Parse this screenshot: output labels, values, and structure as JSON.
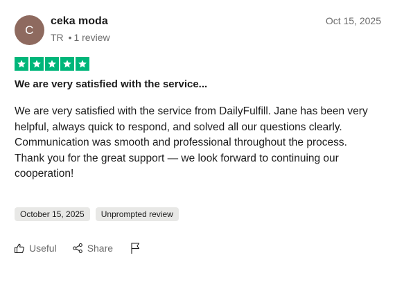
{
  "reviewer": {
    "initial": "C",
    "name": "ceka moda",
    "country": "TR",
    "separator": "•",
    "review_count": "1 review",
    "avatar_color": "#8e6a5f"
  },
  "review": {
    "date": "Oct 15, 2025",
    "rating": 5,
    "star_color": "#00b67a",
    "title": "We are very satisfied with the service...",
    "body_paragraphs": [
      "We are very satisfied with the service from DailyFulfill. Jane has been very helpful, always quick to respond, and solved all our questions clearly. Communication was smooth and professional throughout the process.",
      "Thank you for the great support — we look forward to continuing our cooperation!"
    ]
  },
  "tags": {
    "experience_date": "October 15, 2025",
    "review_type": "Unprompted review"
  },
  "actions": {
    "useful_label": "Useful",
    "share_label": "Share",
    "icons": [
      "thumbs-up-icon",
      "share-icon",
      "flag-icon"
    ]
  }
}
